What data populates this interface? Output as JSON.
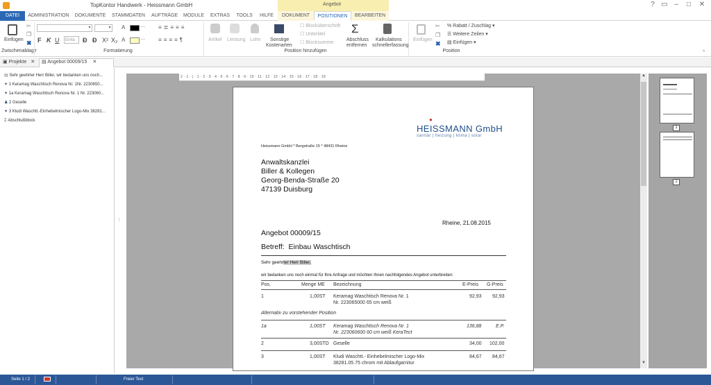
{
  "window": {
    "title": "TopKontor Handwerk -  Heissmann GmbH",
    "context_group": "Angebot"
  },
  "tabs": [
    "DATEI",
    "ADMINISTRATION",
    "DOKUMENTE",
    "STAMMDATEN",
    "AUFTRÄGE",
    "MODULE",
    "EXTRAS",
    "TOOLS",
    "HILFE",
    "DOKUMENT",
    "POSITIONEN",
    "BEARBEITEN"
  ],
  "ribbon": {
    "paste": "Einfügen",
    "clipboard_group": "Zwischenablage",
    "format_group": "Formatierung",
    "font_placeholder": "Einfa",
    "artikel": "Artikel",
    "leistung": "Leistung",
    "lohn": "Lohn",
    "sonstige": "Sonstige",
    "kostenarten": "Kostenarten",
    "blockueberschrift": "Blocküberschrift",
    "untertitel": "Untertitel",
    "blocksumme": "Blocksumme",
    "abschluss1": "Abschluss",
    "abschluss2": "entfernen",
    "kalk1": "Kalkulations",
    "kalk2": "schnellerfassung",
    "pos_add_group": "Position hinzufügen",
    "einfuegen2": "Einfügen",
    "rabatt": "Rabatt / Zuschlag",
    "weitere": "Weitere Zeilen",
    "einfuegen3": "Einfügen",
    "position_group": "Position"
  },
  "doctabs": {
    "projekte": "Projekte",
    "angebot": "Angebot 00009/15"
  },
  "tree": [
    "Sehr geehrter Herr Biller,  wir bedanken uns noch...",
    "1 Keramag Waschtisch Renova Nr. 1Nr. 2230650...",
    "1a Keramag Waschtisch Renova Nr. 1 Nr. 223060...",
    "2 Geselle",
    "3 Kludi Waschtt.-Einhebelmischer Logo-Mix 38281...",
    "Abschlußblock"
  ],
  "ruler": "2 · 1 · | · 1 · 2 · 3 · 4 · 5 · 6 · 7 · 8 · 9 · 10 · 11 · 12 · 13 · 14 · 15 · 16 · 17 · 18 · 19",
  "letter": {
    "logo_main": "HEISSMANN GmbH",
    "logo_sub": "sanitär | heizung | klima | solar",
    "sender": "Heissmann GmbH * Bergstraße 15 * 48431 Rheine",
    "addr1": "Anwaltskanzlei",
    "addr2": "Biller & Kollegen",
    "addr3": "Georg-Benda-Straße 20",
    "addr4": "47139 Duisburg",
    "place_date": "Rheine,  21.08.2015",
    "title": "Angebot 00009/15",
    "subject_label": "Betreff:",
    "subject": "Einbau Waschtisch",
    "greeting_pre": "Sehr geehr",
    "greeting_sel": "ter Herr Biller,",
    "intro": "wir bedanken uns noch einmal für Ihre Anfrage und möchten Ihnen nachfolgendes Angebot unterbreiten:",
    "headers": {
      "pos": "Pos.",
      "menge": "Menge ME",
      "bez": "Bezeichnung",
      "ep": "E-Preis",
      "gp": "G-Preis"
    },
    "rows": [
      {
        "pos": "1",
        "menge": "1,00ST",
        "bez1": "Keramag Waschtisch Renova Nr. 1",
        "bez2": "Nr. 223065000 65 cm weiß",
        "ep": "92,93",
        "gp": "92,93",
        "italic": false
      },
      {
        "pos": "1a",
        "menge": "1,00ST",
        "bez1": "Keramag Waschtisch Renova Nr. 1",
        "bez2": "Nr. 223060600 60 cm weiß KeraTect",
        "ep": "136,88",
        "gp": "E.P.",
        "italic": true
      },
      {
        "pos": "2",
        "menge": "3,00STD",
        "bez1": "Geselle",
        "bez2": "",
        "ep": "34,00",
        "gp": "102,00",
        "italic": false
      },
      {
        "pos": "3",
        "menge": "1,00ST",
        "bez1": "Kludi Waschtt.- Einhebelmischer Logo-Mix",
        "bez2": "38281.05.75 chrom mit Ablaufgarnitur",
        "ep": "84,67",
        "gp": "84,67",
        "italic": false
      }
    ],
    "alternative": "Alternativ zu vorstehender Position"
  },
  "thumbs": [
    "1",
    "2"
  ],
  "status": {
    "page": "Seite 1 / 2",
    "text": "Freier Text"
  },
  "colors": {
    "accent": "#2b5797",
    "logo_red": "#c8372d",
    "logo_blue": "#1f4e8c"
  }
}
